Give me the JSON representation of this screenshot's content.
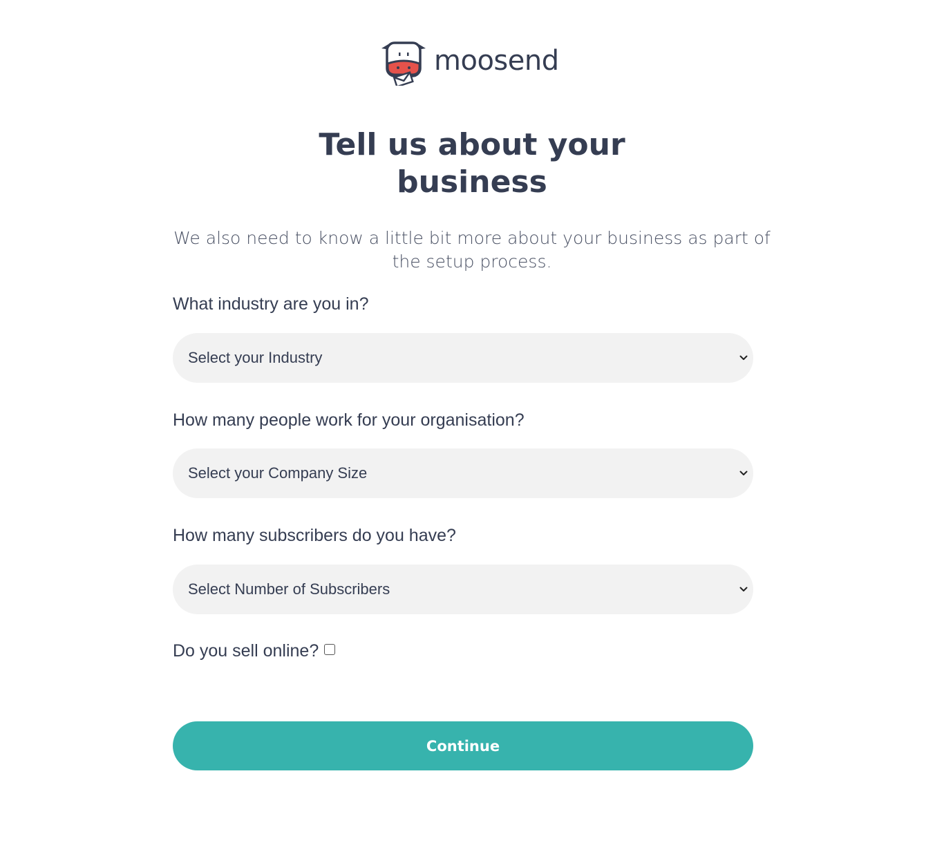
{
  "brand": {
    "name": "moosend",
    "logo_icon": "cow-mascot-icon"
  },
  "header": {
    "title": "Tell us about your business",
    "subtitle": "We also need to know a little bit more about your business as part of the setup process."
  },
  "form": {
    "industry": {
      "label": "What industry are you in?",
      "placeholder": "Select your Industry",
      "icon": "chevron-down-icon"
    },
    "company_size": {
      "label": "How many people work for your organisation?",
      "placeholder": "Select your Company Size",
      "icon": "chevron-down-icon"
    },
    "subscribers": {
      "label": "How many subscribers do you have?",
      "placeholder": "Select Number of Subscribers",
      "icon": "chevron-down-icon"
    },
    "sell_online": {
      "label": "Do you sell online?",
      "checked": false
    },
    "continue_label": "Continue"
  },
  "colors": {
    "text": "#353d52",
    "field_bg": "#f2f2f2",
    "accent": "#37b3ad",
    "logo_red": "#e5524b"
  }
}
